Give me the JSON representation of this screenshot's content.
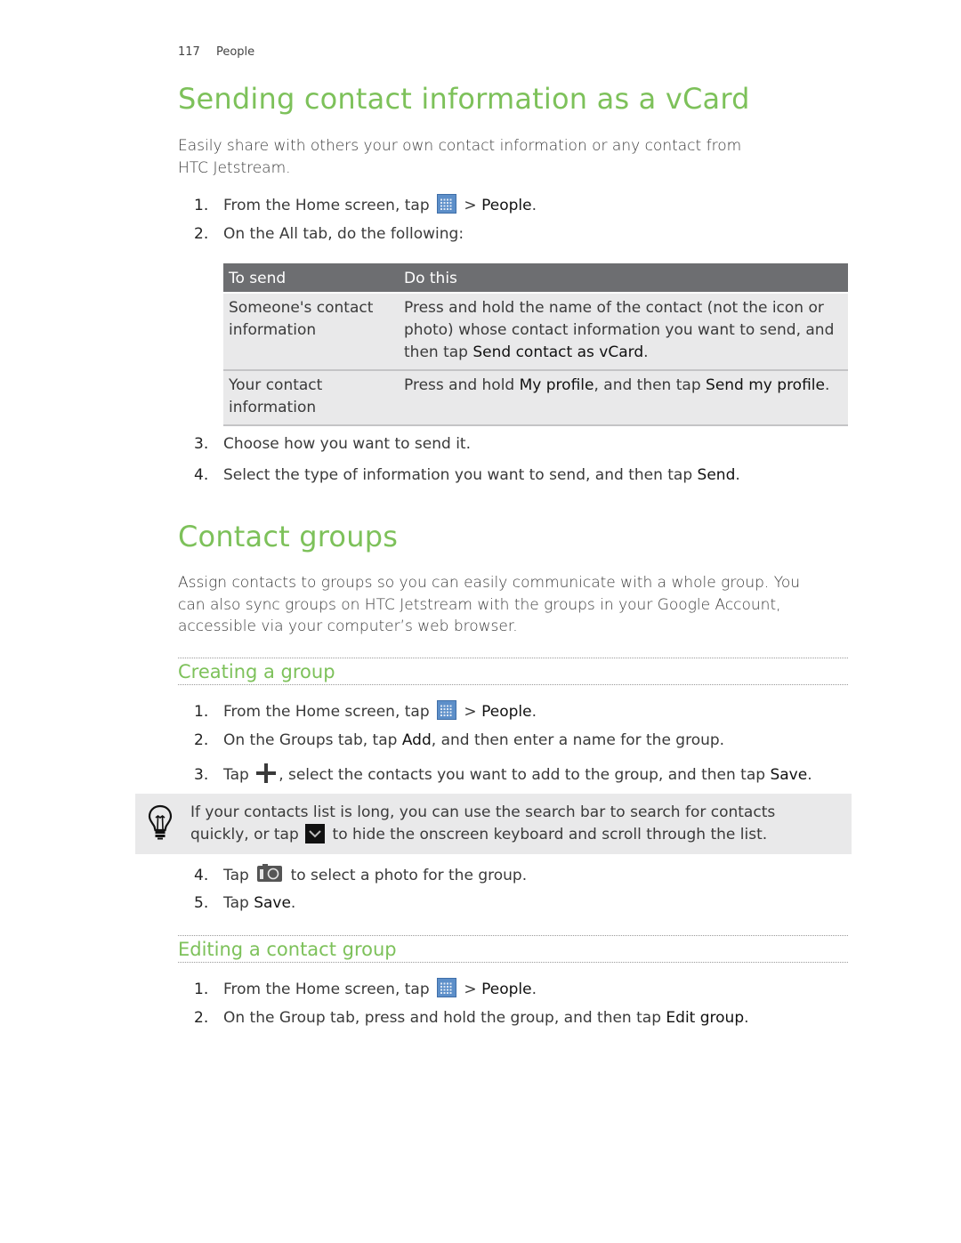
{
  "header": {
    "page_number": "117",
    "section": "People"
  },
  "section1": {
    "title": "Sending contact information as a vCard",
    "intro_line1": "Easily share with others your own contact information or any contact from",
    "intro_line2": "HTC Jetstream.",
    "steps": [
      {
        "n": "1.",
        "pre": "From the Home screen, tap",
        "icon": "apps-grid-icon",
        "post": " > ",
        "ui": "People",
        "end": "."
      },
      {
        "n": "2.",
        "text": "On the All tab, do the following:"
      },
      {
        "n": "3.",
        "text": "Choose how you want to send it."
      },
      {
        "n": "4.",
        "pre": "Select the type of information you want to send, and then tap ",
        "ui": "Send",
        "end": "."
      }
    ],
    "table": {
      "headers": [
        "To send",
        "Do this"
      ],
      "rows": [
        {
          "col1": "Someone's contact information",
          "col2_pre": "Press and hold the name of the contact (not the icon or photo) whose contact information you want to send, and then tap ",
          "col2_ui": "Send contact as vCard",
          "col2_end": "."
        },
        {
          "col1": "Your contact information",
          "col2_pre": "Press and hold ",
          "col2_ui1": "My profile",
          "col2_mid": ", and then tap ",
          "col2_ui2": "Send my profile",
          "col2_end": "."
        }
      ]
    }
  },
  "section2": {
    "title": "Contact groups",
    "intro_lines": [
      "Assign contacts to groups so you can easily communicate with a whole group. You",
      "can also sync groups on HTC Jetstream with the groups in your Google Account,",
      "accessible via your computer’s web browser."
    ],
    "creating": {
      "title": "Creating a group",
      "steps": [
        {
          "n": "1.",
          "pre": "From the Home screen, tap",
          "post": " > ",
          "ui": "People",
          "end": "."
        },
        {
          "n": "2.",
          "pre": "On the Groups tab, tap ",
          "ui": "Add",
          "end": ", and then enter a name for the group."
        },
        {
          "n": "3.",
          "pre": "Tap",
          "post": ", select the contacts you want to add to the group, and then tap ",
          "ui": "Save",
          "end": "."
        },
        {
          "n": "4.",
          "pre": "Tap",
          "end": " to select a photo for the group."
        },
        {
          "n": "5.",
          "pre": "Tap ",
          "ui": "Save",
          "end": "."
        }
      ],
      "tip": {
        "line1": "If your contacts list is long, you can use the search bar to search for contacts",
        "line2_pre": "quickly, or tap",
        "line2_post": " to hide the onscreen keyboard and scroll through the list."
      }
    },
    "editing": {
      "title": "Editing a contact group",
      "steps": [
        {
          "n": "1.",
          "pre": "From the Home screen, tap",
          "post": " > ",
          "ui": "People",
          "end": "."
        },
        {
          "n": "2.",
          "pre": "On the Group tab, press and hold the group, and then tap ",
          "ui": "Edit group",
          "end": "."
        }
      ]
    }
  },
  "colors": {
    "heading_green": "#7dc15a",
    "table_header": "#6d6e71",
    "table_cell": "#e9e9ea"
  }
}
